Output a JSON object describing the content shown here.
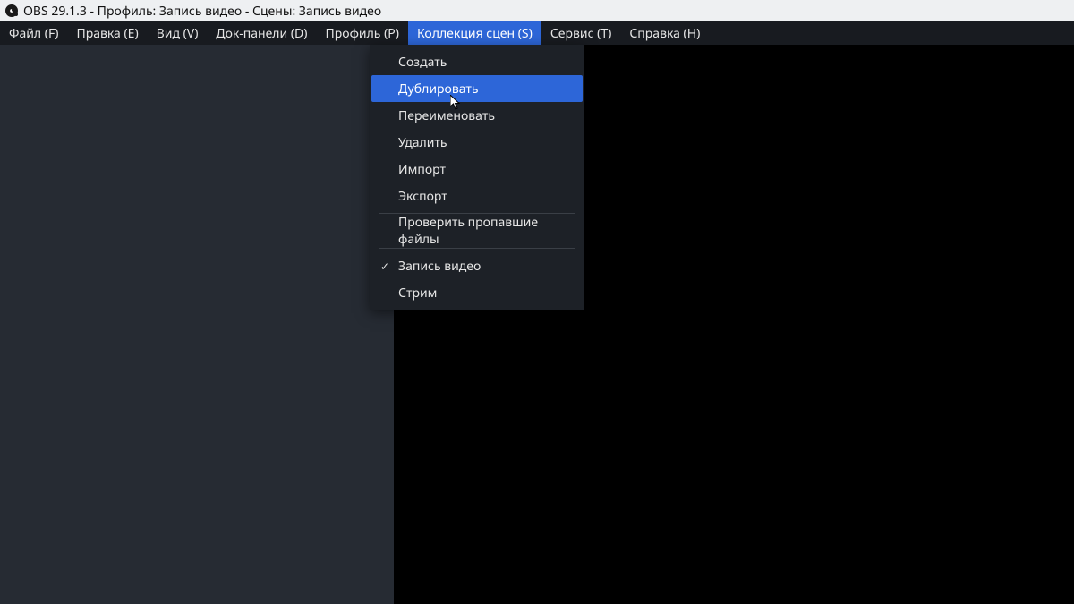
{
  "title_bar": {
    "title": "OBS 29.1.3 - Профиль: Запись видео - Сцены: Запись видео"
  },
  "menu_bar": {
    "items": [
      {
        "label": "Файл (F)"
      },
      {
        "label": "Правка (E)"
      },
      {
        "label": "Вид (V)"
      },
      {
        "label": "Док-панели (D)"
      },
      {
        "label": "Профиль (P)"
      },
      {
        "label": "Коллекция сцен (S)"
      },
      {
        "label": "Сервис (T)"
      },
      {
        "label": "Справка (H)"
      }
    ],
    "active_index": 5
  },
  "dropdown": {
    "items": [
      {
        "label": "Создать"
      },
      {
        "label": "Дублировать"
      },
      {
        "label": "Переименовать"
      },
      {
        "label": "Удалить"
      },
      {
        "label": "Импорт"
      },
      {
        "label": "Экспорт"
      }
    ],
    "group2": [
      {
        "label": "Проверить пропавшие файлы"
      }
    ],
    "group3": [
      {
        "label": "Запись видео",
        "checked": true
      },
      {
        "label": "Стрим",
        "checked": false
      }
    ],
    "highlight_index": 1
  }
}
